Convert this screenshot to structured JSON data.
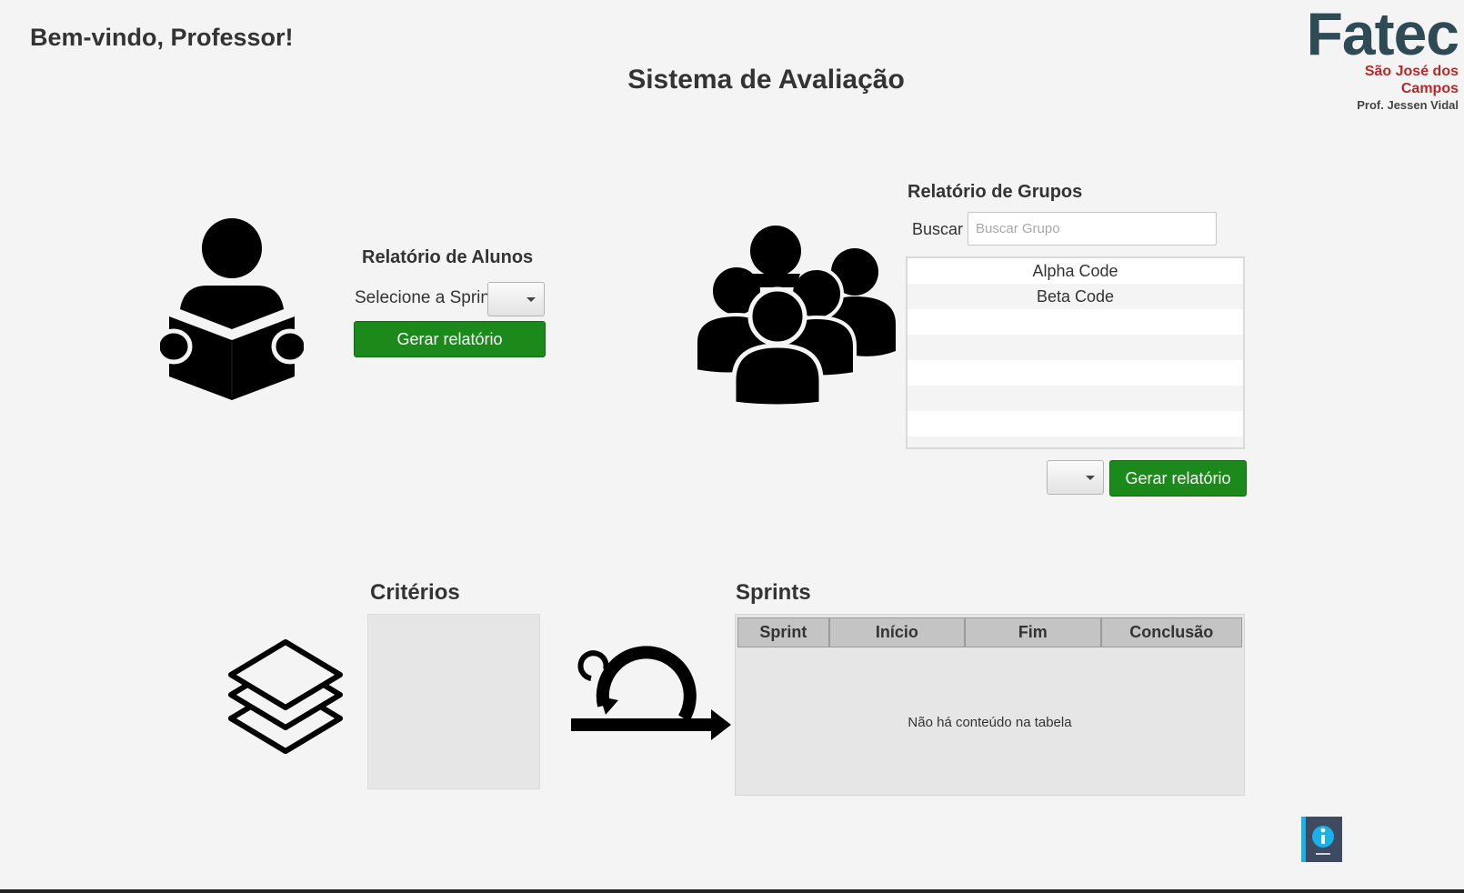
{
  "header": {
    "welcome": "Bem-vindo, Professor!",
    "title": "Sistema de Avaliação"
  },
  "logo": {
    "brand": "Fatec",
    "campus_line1": "São José dos",
    "campus_line2": "Campos",
    "prof": "Prof. Jessen Vidal"
  },
  "alunos": {
    "title": "Relatório de Alunos",
    "sprint_label": "Selecione a Sprint",
    "sprint_selected": "",
    "button": "Gerar relatório",
    "icon": "reader-icon"
  },
  "grupos": {
    "title": "Relatório de Grupos",
    "search_label": "Buscar",
    "search_placeholder": "Buscar Grupo",
    "search_value": "",
    "items": [
      "Alpha Code",
      "Beta Code",
      "",
      "",
      "",
      "",
      "",
      ""
    ],
    "select_value": "",
    "button": "Gerar relatório",
    "icon": "group-icon"
  },
  "criterios": {
    "title": "Critérios",
    "icon": "layers-icon"
  },
  "sprints": {
    "title": "Sprints",
    "columns": [
      "Sprint",
      "Início",
      "Fim",
      "Conclusão"
    ],
    "empty_message": "Não há conteúdo na tabela",
    "icon": "sprint-cycle-icon"
  },
  "help": {
    "icon": "info-book-icon"
  },
  "colors": {
    "background": "#f4f4f4",
    "primary_button": "#1b8a1b",
    "logo_brand": "#2d4a55",
    "logo_campus": "#b22a2a",
    "help_accent": "#1ab0e8"
  }
}
